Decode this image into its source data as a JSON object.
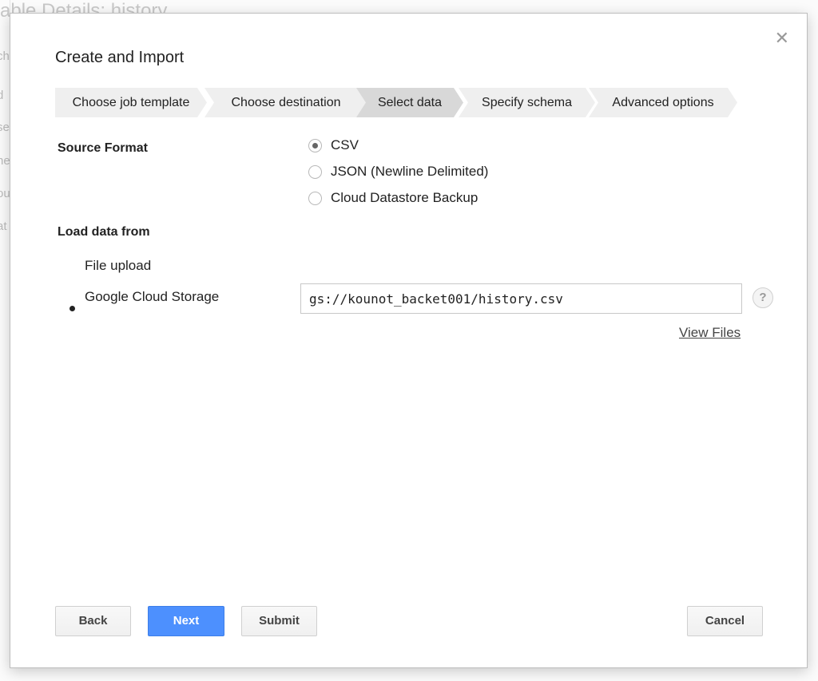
{
  "background": {
    "title": "able Details: history",
    "side_fragments": [
      "ch",
      "d",
      "se",
      "ne",
      "ou",
      "at"
    ]
  },
  "dialog": {
    "title": "Create and Import",
    "close_icon": "close-icon",
    "steps": [
      {
        "label": "Choose job template",
        "active": false
      },
      {
        "label": "Choose destination",
        "active": false
      },
      {
        "label": "Select data",
        "active": true
      },
      {
        "label": "Specify schema",
        "active": false
      },
      {
        "label": "Advanced options",
        "active": false
      }
    ],
    "source_format": {
      "label": "Source Format",
      "options": [
        {
          "label": "CSV",
          "selected": true
        },
        {
          "label": "JSON (Newline Delimited)",
          "selected": false
        },
        {
          "label": "Cloud Datastore Backup",
          "selected": false
        }
      ]
    },
    "load_data": {
      "label": "Load data from",
      "options": [
        {
          "label": "File upload",
          "selected": false
        },
        {
          "label": "Google Cloud Storage",
          "selected": true
        }
      ],
      "gcs_value": "gs://kounot_backet001/history.csv",
      "help_label": "?",
      "view_files_label": "View Files"
    },
    "buttons": {
      "back": "Back",
      "next": "Next",
      "submit": "Submit",
      "cancel": "Cancel"
    },
    "colors": {
      "primary": "#4d90fe",
      "active_step": "#d8d8d8",
      "step": "#efefef"
    }
  }
}
